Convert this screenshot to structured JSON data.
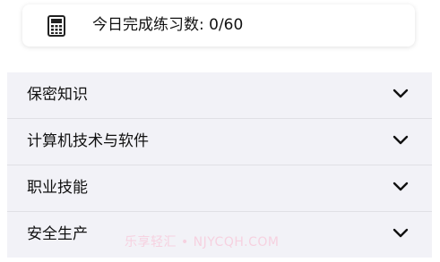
{
  "stats": {
    "icon": "calculator-icon",
    "label": "今日完成练习数: 0/60"
  },
  "categories": [
    {
      "label": "保密知识",
      "icon": "chevron-down-icon"
    },
    {
      "label": "计算机技术与软件",
      "icon": "chevron-down-icon"
    },
    {
      "label": "职业技能",
      "icon": "chevron-down-icon"
    },
    {
      "label": "安全生产",
      "icon": "chevron-down-icon"
    }
  ],
  "watermark": "乐享轻汇 • NJYCQH.COM",
  "colors": {
    "list_background": "#f2f2f7",
    "card_background": "#ffffff",
    "text": "#111111",
    "watermark": "#ff96b4"
  }
}
